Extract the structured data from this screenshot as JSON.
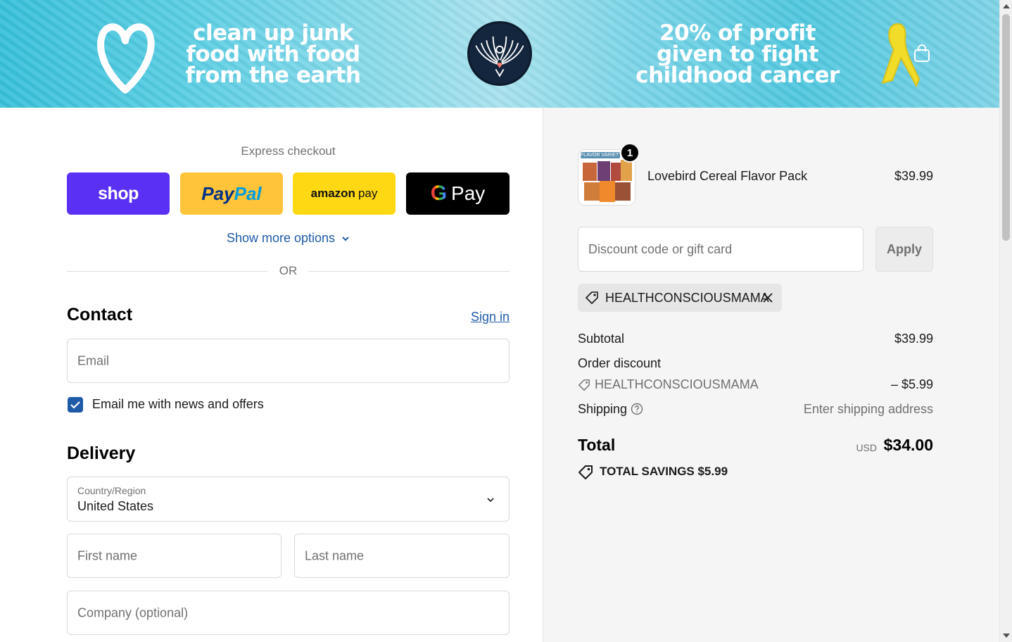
{
  "banner": {
    "left_text": "clean up junk food with food from the earth",
    "right_text": "20% of profit given to fight childhood cancer"
  },
  "express": {
    "label": "Express checkout",
    "shop_label": "shop",
    "paypal_part1": "Pay",
    "paypal_part2": "Pal",
    "amazon_bold": "amazon",
    "amazon_rest": "pay",
    "gpay_g": "G",
    "gpay_rest": "Pay",
    "more_options": "Show more options",
    "or": "OR"
  },
  "contact": {
    "title": "Contact",
    "sign_in": "Sign in",
    "email_placeholder": "Email",
    "newsletter_label": "Email me with news and offers",
    "newsletter_checked": true
  },
  "delivery": {
    "title": "Delivery",
    "country_label": "Country/Region",
    "country_value": "United States",
    "first_name_placeholder": "First name",
    "last_name_placeholder": "Last name",
    "company_placeholder": "Company (optional)"
  },
  "summary": {
    "item": {
      "quantity": "1",
      "name": "Lovebird Cereal Flavor Pack",
      "price": "$39.99",
      "thumb_label": "FLAVOR VARIETY"
    },
    "discount_placeholder": "Discount code or gift card",
    "apply_label": "Apply",
    "applied_code": "HEALTHCONSCIOUSMAMA",
    "subtotal_label": "Subtotal",
    "subtotal_value": "$39.99",
    "order_discount_label": "Order discount",
    "order_discount_code": "HEALTHCONSCIOUSMAMA",
    "order_discount_value": "– $5.99",
    "shipping_label": "Shipping",
    "shipping_value": "Enter shipping address",
    "total_label": "Total",
    "total_currency": "USD",
    "total_value": "$34.00",
    "savings_text": "TOTAL SAVINGS  $5.99"
  },
  "colors": {
    "accent": "#1f5aa8",
    "shop_purple": "#5a31f4",
    "paypal_yellow": "#ffc439",
    "amazon_yellow": "#ffd814",
    "banner_cyan": "#58cde3"
  }
}
